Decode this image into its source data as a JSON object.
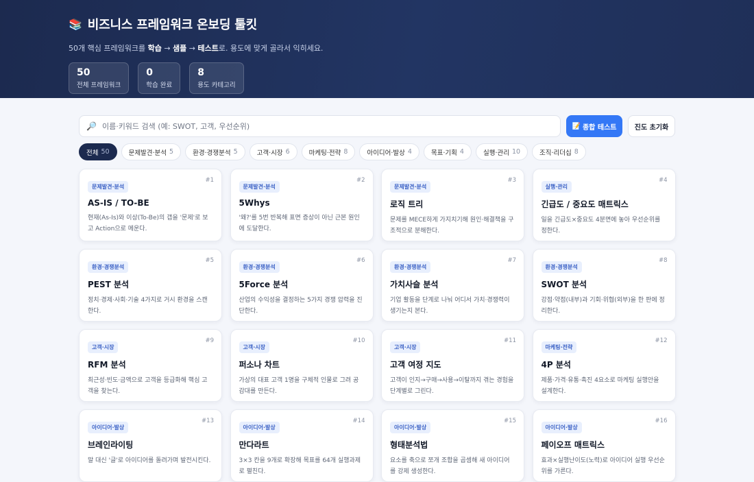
{
  "header": {
    "icon": "books-icon",
    "title": "비즈니스 프레임워크 온보딩 툴킷",
    "subtitle_pre": "50개 핵심 프레임워크를 ",
    "subtitle_b1": "학습",
    "subtitle_arrow1": " → ",
    "subtitle_b2": "샘플",
    "subtitle_arrow2": " → ",
    "subtitle_b3": "테스트",
    "subtitle_post": "로. 용도에 맞게 골라서 익히세요."
  },
  "stats": [
    {
      "num": "50",
      "label": "전체 프레임워크"
    },
    {
      "num": "0",
      "label": "학습 완료"
    },
    {
      "num": "8",
      "label": "용도 카테고리"
    }
  ],
  "search": {
    "placeholder": "이름·키워드 검색 (예: SWOT, 고객, 우선순위)",
    "value": ""
  },
  "buttons": {
    "test_icon": "📝",
    "test": "종합 테스트",
    "reset": "진도 초기화"
  },
  "filters": [
    {
      "label": "전체",
      "count": "50",
      "active": true
    },
    {
      "label": "문제발견·분석",
      "count": "5"
    },
    {
      "label": "환경·경쟁분석",
      "count": "5"
    },
    {
      "label": "고객·시장",
      "count": "6"
    },
    {
      "label": "마케팅·전략",
      "count": "8"
    },
    {
      "label": "아이디어·발상",
      "count": "4"
    },
    {
      "label": "목표·기획",
      "count": "4"
    },
    {
      "label": "실행·관리",
      "count": "10"
    },
    {
      "label": "조직·리더십",
      "count": "8"
    }
  ],
  "cards": [
    {
      "tag": "문제발견·분석",
      "num": "#1",
      "title": "AS-IS / TO-BE",
      "desc": "현재(As-Is)와 이상(To-Be)의 갭을 '문제'로 보고 Action으로 메운다."
    },
    {
      "tag": "문제발견·분석",
      "num": "#2",
      "title": "5Whys",
      "desc": "'왜?'를 5번 반복해 표면 증상이 아닌 근본 원인에 도달한다."
    },
    {
      "tag": "문제발견·분석",
      "num": "#3",
      "title": "로직 트리",
      "desc": "문제를 MECE하게 가지치기해 원인·해결책을 구조적으로 분해한다."
    },
    {
      "tag": "실행·관리",
      "num": "#4",
      "title": "긴급도 / 중요도 매트릭스",
      "desc": "일을 긴급도×중요도 4분면에 놓아 우선순위를 정한다."
    },
    {
      "tag": "환경·경쟁분석",
      "num": "#5",
      "title": "PEST 분석",
      "desc": "정치·경제·사회·기술 4가지로 거시 환경을 스캔한다."
    },
    {
      "tag": "환경·경쟁분석",
      "num": "#6",
      "title": "5Force 분석",
      "desc": "산업의 수익성을 결정하는 5가지 경쟁 압력을 진단한다."
    },
    {
      "tag": "환경·경쟁분석",
      "num": "#7",
      "title": "가치사슬 분석",
      "desc": "기업 활동을 단계로 나눠 어디서 가치·경쟁력이 생기는지 본다."
    },
    {
      "tag": "환경·경쟁분석",
      "num": "#8",
      "title": "SWOT 분석",
      "desc": "강점·약점(내부)과 기회·위협(외부)을 한 판에 정리한다."
    },
    {
      "tag": "고객·시장",
      "num": "#9",
      "title": "RFM 분석",
      "desc": "최근성·빈도·금액으로 고객을 등급화해 핵심 고객을 찾는다."
    },
    {
      "tag": "고객·시장",
      "num": "#10",
      "title": "퍼소나 차트",
      "desc": "가상의 대표 고객 1명을 구체적 인물로 그려 공감대를 만든다."
    },
    {
      "tag": "고객·시장",
      "num": "#11",
      "title": "고객 여정 지도",
      "desc": "고객이 인지→구매→사용→이탈까지 겪는 경험을 단계별로 그린다."
    },
    {
      "tag": "마케팅·전략",
      "num": "#12",
      "title": "4P 분석",
      "desc": "제품·가격·유통·촉진 4요소로 마케팅 실행안을 설계한다."
    },
    {
      "tag": "아이디어·발상",
      "num": "#13",
      "title": "브레인라이팅",
      "desc": "말 대신 '글'로 아이디어를 돌려가며 발전시킨다."
    },
    {
      "tag": "아이디어·발상",
      "num": "#14",
      "title": "만다라트",
      "desc": "3×3 칸을 9개로 확장해 목표를 64개 실행과제로 펼친다."
    },
    {
      "tag": "아이디어·발상",
      "num": "#15",
      "title": "형태분석법",
      "desc": "요소를 축으로 쪼개 조합을 곱셈해 새 아이디어를 강제 생성한다."
    },
    {
      "tag": "아이디어·발상",
      "num": "#16",
      "title": "페이오프 매트릭스",
      "desc": "효과×실행난이도(노력)로 아이디어 실행 우선순위를 가른다."
    }
  ]
}
